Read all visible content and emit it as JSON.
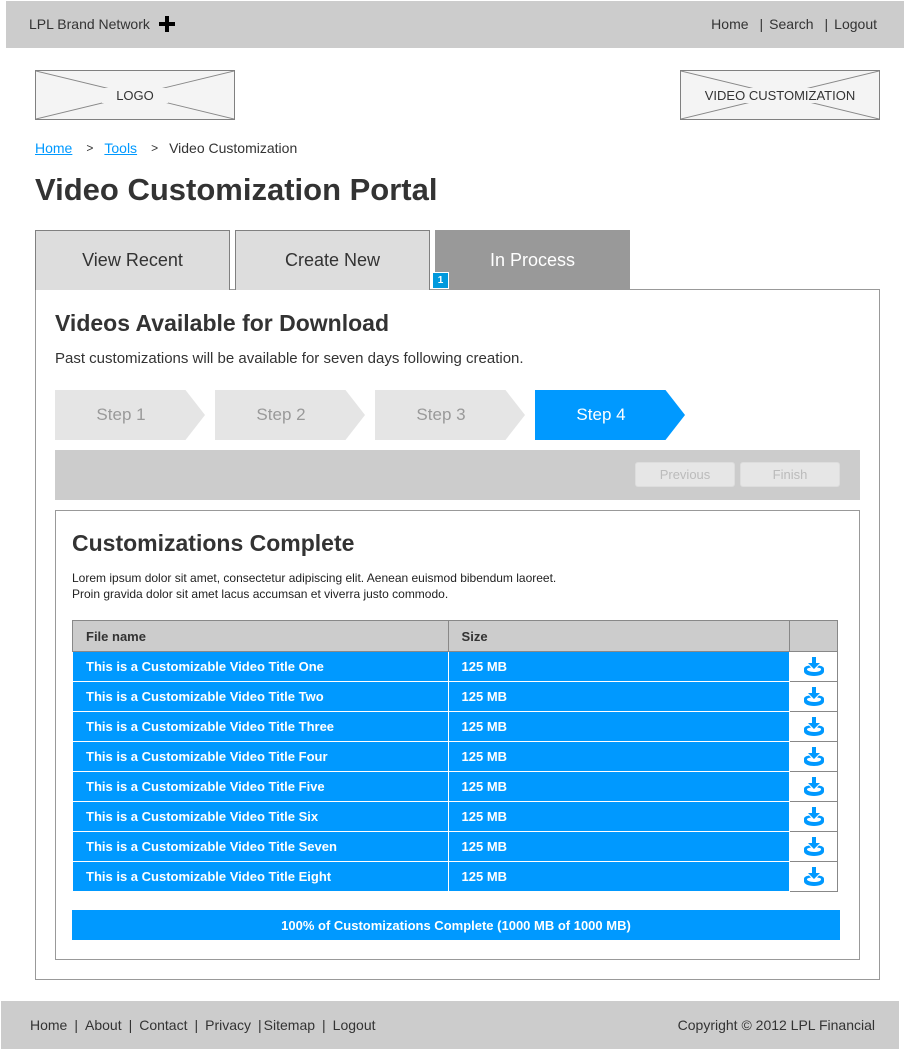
{
  "topbar": {
    "brand": "LPL Brand Network",
    "brand_icon": "plus-icon",
    "nav": [
      "Home",
      "Search",
      "Logout"
    ],
    "separator": "|"
  },
  "header": {
    "logo_label": "LOGO",
    "section_placeholder_label": "VIDEO CUSTOMIZATION"
  },
  "breadcrumb": {
    "items": [
      "Home",
      "Tools"
    ],
    "current": "Video Customization",
    "separator": ">"
  },
  "page_title": "Video Customization Portal",
  "tabs": [
    {
      "label": "View Recent",
      "active": false
    },
    {
      "label": "Create New",
      "active": false
    },
    {
      "label": "In Process",
      "active": true
    }
  ],
  "in_process_badge": "1",
  "section": {
    "title": "Videos Available for Download",
    "description": "Past customizations will be available for seven days following creation."
  },
  "steps": [
    {
      "label": "Step 1",
      "active": false
    },
    {
      "label": "Step 2",
      "active": false
    },
    {
      "label": "Step 3",
      "active": false
    },
    {
      "label": "Step 4",
      "active": true
    }
  ],
  "nav_buttons": {
    "previous": "Previous",
    "finish": "Finish"
  },
  "complete": {
    "title": "Customizations Complete",
    "description_line1": "Lorem ipsum dolor sit amet, consectetur adipiscing elit. Aenean euismod bibendum laoreet.",
    "description_line2": "Proin gravida dolor sit amet lacus accumsan et viverra justo commodo."
  },
  "table": {
    "columns": [
      "File name",
      "Size",
      ""
    ],
    "rows": [
      {
        "name": "This is a Customizable Video Title One",
        "size": "125 MB",
        "action_icon": "download-icon"
      },
      {
        "name": "This is a Customizable Video Title Two",
        "size": "125 MB",
        "action_icon": "download-icon"
      },
      {
        "name": "This is a Customizable Video Title Three",
        "size": "125 MB",
        "action_icon": "download-icon"
      },
      {
        "name": "This is a Customizable Video Title Four",
        "size": "125 MB",
        "action_icon": "download-icon"
      },
      {
        "name": "This is a Customizable Video Title Five",
        "size": "125 MB",
        "action_icon": "download-icon"
      },
      {
        "name": "This is a Customizable Video Title Six",
        "size": "125 MB",
        "action_icon": "download-icon"
      },
      {
        "name": "This is a Customizable Video Title Seven",
        "size": "125 MB",
        "action_icon": "download-icon"
      },
      {
        "name": "This is a Customizable Video Title Eight",
        "size": "125 MB",
        "action_icon": "download-icon"
      }
    ]
  },
  "progress": {
    "label": "100% of Customizations Complete (1000 MB of 1000 MB)",
    "percent": 100
  },
  "footer": {
    "nav": [
      "Home",
      "About",
      "Contact",
      "Privacy",
      "Sitemap",
      "Logout"
    ],
    "separator": "|",
    "copyright": "Copyright © 2012 LPL Financial"
  },
  "colors": {
    "accent": "#0099ff",
    "bar_gray": "#cccccc",
    "active_tab": "#999999",
    "step_inactive": "#e5e5e5"
  }
}
